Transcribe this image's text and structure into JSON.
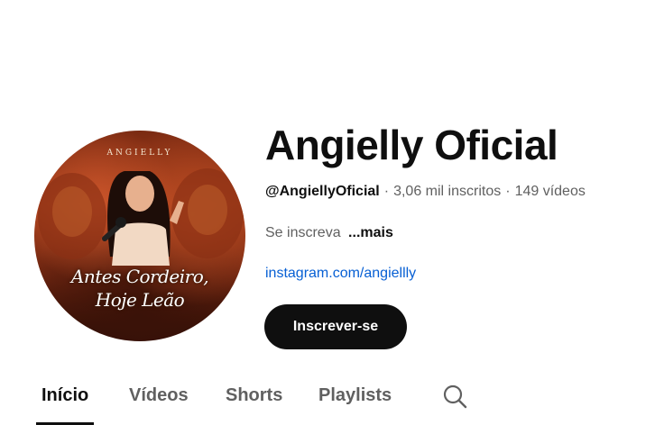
{
  "avatar": {
    "top_label": "ANGIELLY",
    "title_line1": "Antes Cordeiro,",
    "title_line2": "Hoje Leão",
    "colors": {
      "background": "#a8401c",
      "text": "#ffffff"
    }
  },
  "channel": {
    "name": "Angielly Oficial",
    "handle": "@AngiellyOficial",
    "subscribers": "3,06 mil inscritos",
    "videos": "149 vídeos",
    "separator": "·",
    "description": "Se inscreva",
    "more_label": "...mais",
    "link": "instagram.com/angiellly"
  },
  "actions": {
    "subscribe_label": "Inscrever-se"
  },
  "tabs": [
    {
      "label": "Início",
      "active": true
    },
    {
      "label": "Vídeos",
      "active": false
    },
    {
      "label": "Shorts",
      "active": false
    },
    {
      "label": "Playlists",
      "active": false
    }
  ],
  "icons": {
    "search": "search-icon"
  },
  "colors": {
    "primary_text": "#0f0f0f",
    "secondary_text": "#606060",
    "link": "#065fd4",
    "button_bg": "#0f0f0f",
    "button_text": "#ffffff"
  }
}
